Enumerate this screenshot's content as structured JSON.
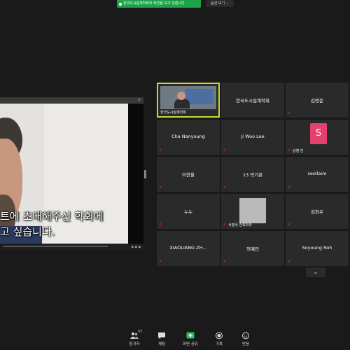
{
  "banner": {
    "share_text": "한국도시설계학회의 화면을 보고 있습니다",
    "view_options": "옵션 보기 ⌄"
  },
  "share": {
    "subtitle_line1": "트에 초대해주신 학회에",
    "subtitle_line2": "고 싶습니다."
  },
  "gallery": {
    "tiles": [
      {
        "name": "",
        "corner": "한국도시설계학회"
      },
      {
        "name": "한국도시설계학회"
      },
      {
        "name": "김명준"
      },
      {
        "name": "Cha Nanyoung"
      },
      {
        "name": "Ji Woo Lee"
      },
      {
        "name": "",
        "corner": "상철 한",
        "avatar": "S"
      },
      {
        "name": "이한울"
      },
      {
        "name": "13 박기훈"
      },
      {
        "name": "seollaim"
      },
      {
        "name": "누누"
      },
      {
        "name": "",
        "corner": "서영국 건축학과"
      },
      {
        "name": "김현우"
      },
      {
        "name": "XIAOLIANG ZH..."
      },
      {
        "name": "허예민"
      },
      {
        "name": "Soyoung Roh"
      }
    ],
    "scroll_icon": "⌄"
  },
  "toolbar": {
    "participants_label": "참가자",
    "participants_count": "57",
    "chat_label": "채팅",
    "share_label": "화면 공유",
    "record_label": "기록",
    "reaction_label": "반응"
  },
  "colors": {
    "share_green": "#1fa34a",
    "active_speaker": "#c7d73a",
    "mute_red": "#e0242b",
    "avatar_pink": "#e5416f"
  },
  "icons": [
    "participants-icon",
    "chat-icon",
    "share-screen-icon",
    "record-icon",
    "reaction-icon",
    "mic-muted-icon"
  ]
}
